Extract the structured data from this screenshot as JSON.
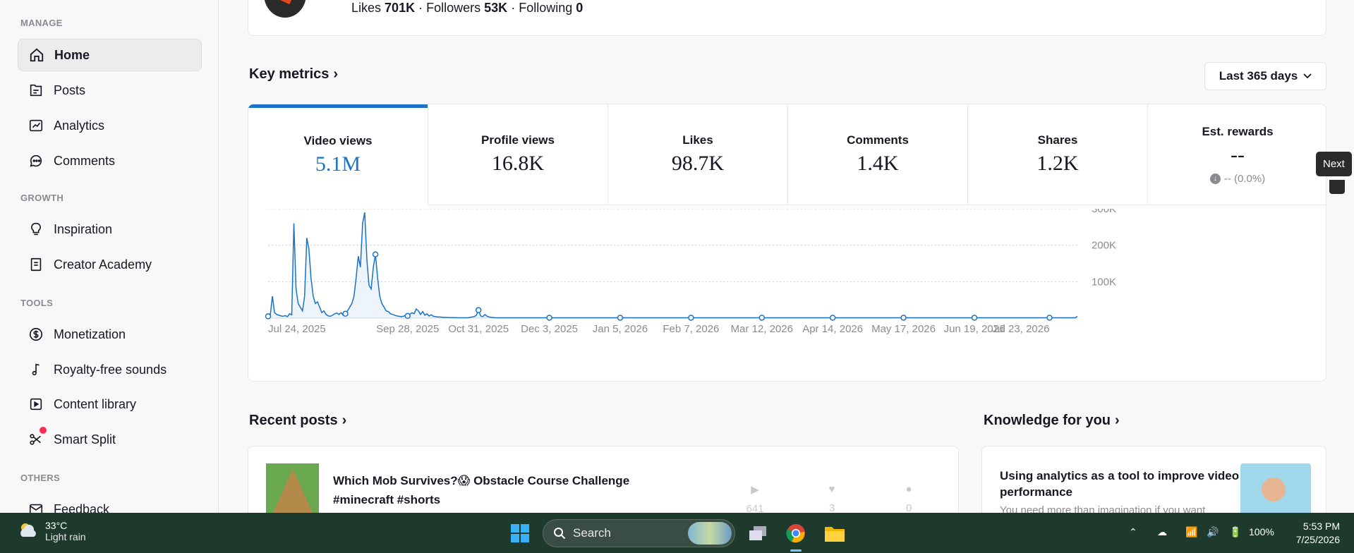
{
  "sidebar": {
    "sections": [
      {
        "title": "MANAGE",
        "items": [
          {
            "label": "Home",
            "icon": "home-icon",
            "active": true
          },
          {
            "label": "Posts",
            "icon": "posts-icon"
          },
          {
            "label": "Analytics",
            "icon": "analytics-icon"
          },
          {
            "label": "Comments",
            "icon": "comments-icon"
          }
        ]
      },
      {
        "title": "GROWTH",
        "items": [
          {
            "label": "Inspiration",
            "icon": "lightbulb-icon"
          },
          {
            "label": "Creator Academy",
            "icon": "book-icon"
          }
        ]
      },
      {
        "title": "TOOLS",
        "items": [
          {
            "label": "Monetization",
            "icon": "dollar-icon"
          },
          {
            "label": "Royalty-free sounds",
            "icon": "music-note-icon"
          },
          {
            "label": "Content library",
            "icon": "play-square-icon"
          },
          {
            "label": "Smart Split",
            "icon": "scissors-icon",
            "badge": true
          }
        ]
      },
      {
        "title": "OTHERS",
        "items": [
          {
            "label": "Feedback",
            "icon": "mail-icon"
          }
        ]
      }
    ]
  },
  "profile": {
    "likes_label": "Likes",
    "likes_value": "701K",
    "followers_label": "Followers",
    "followers_value": "53K",
    "following_label": "Following",
    "following_value": "0",
    "separator": "·"
  },
  "key_metrics": {
    "title": "Key metrics",
    "range": "Last 365 days",
    "tabs": [
      {
        "label": "Video views",
        "value": "5.1M",
        "active": true
      },
      {
        "label": "Profile views",
        "value": "16.8K"
      },
      {
        "label": "Likes",
        "value": "98.7K"
      },
      {
        "label": "Comments",
        "value": "1.4K"
      },
      {
        "label": "Shares",
        "value": "1.2K"
      },
      {
        "label": "Est. rewards",
        "value": "--",
        "sub": "-- (0.0%)"
      }
    ]
  },
  "tooltip": {
    "label": "Next"
  },
  "chart_data": {
    "type": "line",
    "series": [
      {
        "values": [
          5000,
          8000,
          60000,
          15000,
          10000,
          8000,
          6000,
          5000,
          7000,
          4000,
          12000,
          9000,
          260000,
          80000,
          40000,
          30000,
          20000,
          60000,
          220000,
          190000,
          110000,
          60000,
          40000,
          45000,
          30000,
          15000,
          20000,
          10000,
          6000,
          5000,
          8000,
          12000,
          14000,
          10000,
          15000,
          8000,
          12000,
          20000,
          30000,
          40000,
          60000,
          110000,
          170000,
          140000,
          260000,
          290000,
          160000,
          90000,
          80000,
          140000,
          175000,
          110000,
          60000,
          40000,
          30000,
          20000,
          18000,
          12000,
          10000,
          8000,
          6000,
          5000,
          4000,
          5000,
          8000,
          6000,
          10000,
          15000,
          12000,
          25000,
          20000,
          10000,
          18000,
          8000,
          12000,
          6000,
          9000,
          5000,
          4000,
          3000,
          3000,
          2500,
          2000,
          2000,
          1800,
          1500,
          1500,
          1200,
          1200,
          1000,
          1000,
          1000,
          900,
          900,
          2000,
          3000,
          4000,
          8000,
          22000,
          6000,
          4000,
          10000,
          5000,
          3000,
          2000,
          1500,
          1200,
          1000,
          1000,
          1000,
          1000,
          1000,
          1000,
          1000,
          1000,
          1000,
          1000,
          1000,
          1000,
          1000,
          1000,
          1000,
          1000,
          1000,
          1000,
          1000,
          1000,
          1000,
          1000,
          1000,
          1000,
          1000,
          1000,
          1000,
          1000,
          1000,
          1000,
          1000,
          1000,
          1000,
          1000,
          1000,
          1000,
          1000,
          1000,
          1000,
          1000,
          1000,
          1000,
          1000,
          1000,
          1000,
          1000,
          1000,
          1000,
          1000,
          1000,
          1000,
          1000,
          1000,
          1000,
          1000,
          1000,
          1000,
          1000,
          1000,
          1000,
          1000,
          1000,
          1000,
          1000,
          1000,
          1000,
          1000,
          1000,
          1000,
          1000,
          1000,
          1000,
          1000,
          1000,
          1000,
          1000,
          1000,
          1000,
          1000,
          1000,
          1000,
          1000,
          1000,
          1000,
          1000,
          1000,
          1000,
          1000,
          1000,
          1000,
          1000,
          1000,
          1000,
          1000,
          1000,
          1000,
          1000,
          1000,
          1000,
          1000,
          1000,
          1000,
          1000,
          1000,
          1000,
          1000,
          1000,
          1000,
          1000,
          1000,
          1000,
          1000,
          1000,
          1000,
          1000,
          1000,
          1000,
          1000,
          1000,
          1000,
          1000,
          1000,
          1000,
          1000,
          1000,
          1000,
          1000,
          1000,
          1000,
          1000,
          1000,
          1000,
          1000,
          1000,
          1000,
          1000,
          1000,
          1000,
          1000,
          1000,
          1000,
          1000,
          1000,
          1000,
          1000,
          1000,
          1000,
          1000,
          1000,
          1000,
          1000,
          1000,
          1000,
          1000,
          1000,
          1000,
          1000,
          1000,
          1000,
          1000,
          1000,
          1000,
          1000,
          1000,
          1000,
          1000,
          1000,
          1000,
          1000,
          1000,
          1000,
          1000,
          1000,
          1000,
          1000,
          1000,
          1000,
          1000,
          1000,
          1000,
          1000,
          1000,
          1000,
          1000,
          1000,
          1000,
          1000,
          1000,
          1000,
          1000,
          1000,
          1000,
          1000,
          1000,
          1000,
          1000,
          1000,
          1000,
          1000,
          1000,
          1000,
          1000,
          1000,
          1000,
          1000,
          1000,
          1000,
          1000,
          1000,
          1000,
          1000,
          1000,
          1000,
          1000,
          1000,
          1000,
          1000,
          1000,
          1000,
          1000,
          1000,
          1000,
          1000,
          1000,
          1000,
          1000,
          1000,
          1000,
          1000,
          1000,
          1000,
          1000,
          1000,
          1000,
          1000,
          1000,
          1000,
          1000,
          1000,
          1000,
          1000,
          1000,
          1000,
          1000,
          1000,
          1000,
          1000,
          1000,
          1000,
          1000,
          1000,
          1000,
          1000,
          1000,
          1000,
          1000,
          1000,
          1000,
          1000,
          1000,
          1000,
          1000,
          1000,
          1000,
          1000,
          1000,
          1000,
          1000,
          1000,
          1000,
          5000
        ]
      }
    ],
    "xticks": [
      "Jul 24, 2025",
      "Sep 28, 2025",
      "Oct 31, 2025",
      "Dec 3, 2025",
      "Jan 5, 2026",
      "Feb 7, 2026",
      "Mar 12, 2026",
      "Apr 14, 2026",
      "May 17, 2026",
      "Jun 19, 2026",
      "Jul 23, 2026"
    ],
    "yticks": [
      "100K",
      "200K",
      "300K"
    ],
    "ylim": [
      0,
      300000
    ],
    "color": "#1a73c9",
    "grid": true
  },
  "recent_posts": {
    "title": "Recent posts",
    "post": {
      "title": "Which Mob Survives?😱 Obstacle Course Challenge #minecraft #shorts",
      "views": "641",
      "likes": "3",
      "comments": "0"
    }
  },
  "knowledge": {
    "title": "Knowledge for you",
    "card_title": "Using analytics as a tool to improve video performance",
    "card_sub": "You need more than imagination if you want"
  },
  "taskbar": {
    "temp": "33°C",
    "condition": "Light rain",
    "search": "Search",
    "battery": "100%",
    "time": "5:53 PM",
    "date": "7/25/2026"
  }
}
